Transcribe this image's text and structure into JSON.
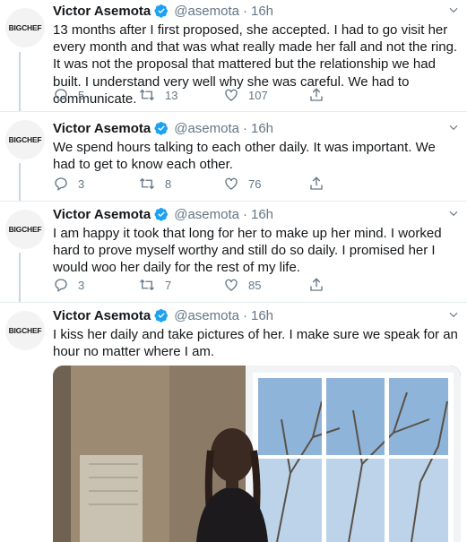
{
  "author": {
    "name": "Victor Asemota",
    "handle": "@asemota",
    "avatar_text": "BIGCHEF"
  },
  "tweets": [
    {
      "time": "16h",
      "text": "13 months after I first proposed, she accepted. I had to go visit her every month and that was what really made her fall and not the ring. It was not the proposal that mattered but the relationship we had built. I understand very well why she was careful. We had to communicate.",
      "replies": "5",
      "retweets": "13",
      "likes": "107"
    },
    {
      "time": "16h",
      "text": "We spend hours talking to each other daily. It was important. We had to get to know each other.",
      "replies": "3",
      "retweets": "8",
      "likes": "76"
    },
    {
      "time": "16h",
      "text": "I am happy it took that long for her to make up her mind. I worked hard to prove myself worthy and still do so daily. I promised her I would woo her daily for the rest of my life.",
      "replies": "3",
      "retweets": "7",
      "likes": "85"
    },
    {
      "time": "16h",
      "text": "I kiss her daily and take pictures of her. I make sure we speak for an hour no matter where I am.",
      "has_media": true
    }
  ],
  "colors": {
    "verified": "#1da1f2",
    "muted": "#657786",
    "line": "#ccd6dd"
  }
}
